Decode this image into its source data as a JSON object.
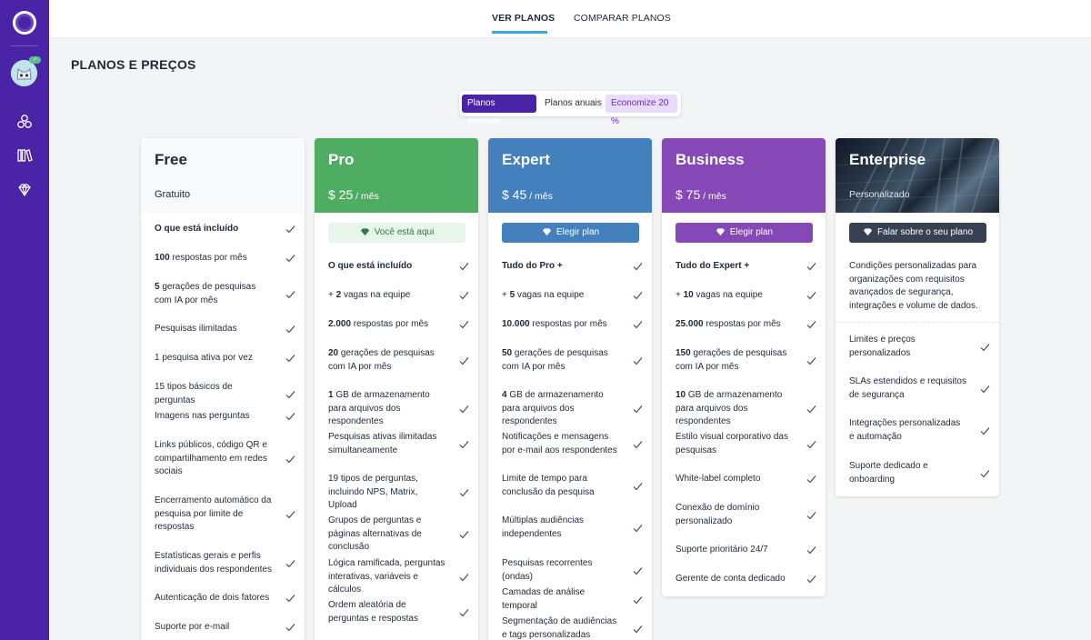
{
  "nav": {
    "tabs": [
      {
        "label": "VER PLANOS",
        "active": true
      },
      {
        "label": "COMPARAR PLANOS",
        "active": false
      }
    ],
    "avatar_badge": "✓"
  },
  "page": {
    "title": "PLANOS E PREÇOS"
  },
  "billing": {
    "monthly": "Planos mensais",
    "annual": "Planos anuais",
    "save": "Economize 20 %"
  },
  "plans": {
    "free": {
      "name": "Free",
      "price": "Gratuito",
      "features": [
        {
          "b": "O que está incluído",
          "t": ""
        },
        {
          "b": "100",
          "t": " respostas por mês"
        },
        {
          "b": "5",
          "t": " gerações de pesquisas com IA por mês"
        },
        {
          "b": "",
          "t": "Pesquisas ilimitadas"
        },
        {
          "b": "",
          "t": "1 pesquisa ativa por vez"
        },
        {
          "b": "",
          "t": "15 tipos básicos de perguntas"
        },
        {
          "b": "",
          "t": "Imagens nas perguntas"
        },
        {
          "b": "",
          "t": "Links públicos, código QR e compartilhamento em redes sociais"
        },
        {
          "b": "",
          "t": "Encerramento automático da pesquisa por limite de respostas"
        },
        {
          "b": "",
          "t": "Estatísticas gerais e perfis individuais dos respondentes"
        },
        {
          "b": "",
          "t": "Autenticação de dois fatores"
        },
        {
          "b": "",
          "t": "Suporte por e-mail"
        }
      ]
    },
    "pro": {
      "name": "Pro",
      "price_amount": "$ 25",
      "price_period": " / mês",
      "button": "Você está aqui",
      "color": "#4ead62",
      "features": [
        {
          "b": "O que está incluído",
          "t": ""
        },
        {
          "b": "",
          "t": "+ ",
          "b2": "2",
          "t2": " vagas na equipe"
        },
        {
          "b": "2.000",
          "t": " respostas por mês"
        },
        {
          "b": "20",
          "t": " gerações de pesquisas com IA por mês"
        },
        {
          "b": "1",
          "t": " GB de armazenamento para arquivos dos respondentes"
        },
        {
          "b": "",
          "t": "Pesquisas ativas ilimitadas simultaneamente"
        },
        {
          "b": "",
          "t": "19 tipos de perguntas, incluindo NPS, Matrix, Upload"
        },
        {
          "b": "",
          "t": "Grupos de perguntas e páginas alternativas de conclusão"
        },
        {
          "b": "",
          "t": "Lógica ramificada, perguntas interativas, variáveis e cálculos"
        },
        {
          "b": "",
          "t": "Ordem aleatória de perguntas e respostas"
        }
      ]
    },
    "expert": {
      "name": "Expert",
      "price_amount": "$ 45",
      "price_period": " / mês",
      "button": "Elegir plan",
      "color": "#4380bd",
      "features": [
        {
          "b": "Tudo do Pro +",
          "t": ""
        },
        {
          "b": "",
          "t": "+ ",
          "b2": "5",
          "t2": " vagas na equipe"
        },
        {
          "b": "10.000",
          "t": " respostas por mês"
        },
        {
          "b": "50",
          "t": " gerações de pesquisas com IA por mês"
        },
        {
          "b": "4",
          "t": " GB de armazenamento para arquivos dos respondentes"
        },
        {
          "b": "",
          "t": "Notificações e mensagens por e-mail aos respondentes"
        },
        {
          "b": "",
          "t": "Limite de tempo para conclusão da pesquisa"
        },
        {
          "b": "",
          "t": "Múltiplas audiências independentes"
        },
        {
          "b": "",
          "t": "Pesquisas recorrentes (ondas)"
        },
        {
          "b": "",
          "t": "Camadas de análise temporal"
        },
        {
          "b": "",
          "t": "Segmentação de audiências e tags personalizadas"
        }
      ]
    },
    "business": {
      "name": "Business",
      "price_amount": "$ 75",
      "price_period": " / mês",
      "button": "Elegir plan",
      "color": "#8647b7",
      "features": [
        {
          "b": "Tudo do Expert +",
          "t": ""
        },
        {
          "b": "",
          "t": "+ ",
          "b2": "10",
          "t2": " vagas na equipe"
        },
        {
          "b": "25.000",
          "t": " respostas por mês"
        },
        {
          "b": "150",
          "t": " gerações de pesquisas com IA por mês"
        },
        {
          "b": "10",
          "t": " GB de armazenamento para arquivos dos respondentes"
        },
        {
          "b": "",
          "t": "Estilo visual corporativo das pesquisas"
        },
        {
          "b": "",
          "t": "White-label completo"
        },
        {
          "b": "",
          "t": "Conexão de domínio personalizado"
        },
        {
          "b": "",
          "t": "Suporte prioritário 24/7"
        },
        {
          "b": "",
          "t": "Gerente de conta dedicado"
        }
      ]
    },
    "enterprise": {
      "name": "Enterprise",
      "price": "Personalizado",
      "button": "Falar sobre o seu plano",
      "description": "Condições personalizadas para organizações com requisitos avançados de segurança, integrações e volume de dados.",
      "features": [
        {
          "b": "",
          "t": "Limites e preços personalizados"
        },
        {
          "b": "",
          "t": "SLAs estendidos e requisitos de segurança"
        },
        {
          "b": "",
          "t": "Integrações personalizadas e automação"
        },
        {
          "b": "",
          "t": "Suporte dedicado e onboarding"
        }
      ]
    }
  }
}
